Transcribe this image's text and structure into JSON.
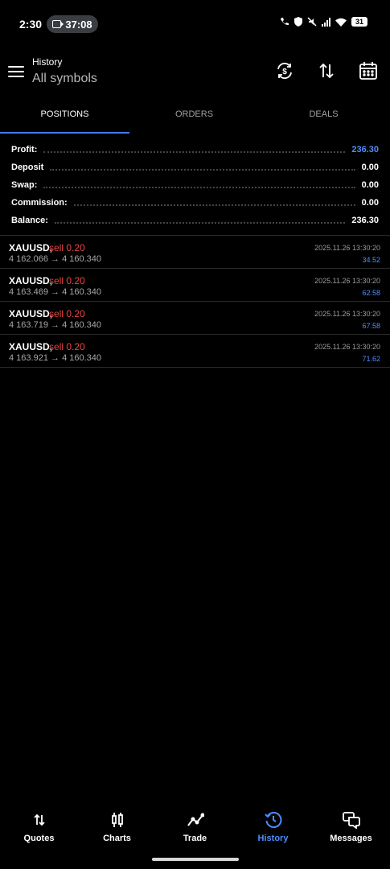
{
  "status_bar": {
    "time": "2:30",
    "call_timer": "37:08",
    "battery": "31"
  },
  "header": {
    "title": "History",
    "subtitle": "All symbols"
  },
  "tabs": [
    {
      "label": "POSITIONS",
      "active": true
    },
    {
      "label": "ORDERS",
      "active": false
    },
    {
      "label": "DEALS",
      "active": false
    }
  ],
  "summary": [
    {
      "label": "Profit:",
      "value": "236.30"
    },
    {
      "label": "Deposit",
      "value": "0.00"
    },
    {
      "label": "Swap:",
      "value": "0.00"
    },
    {
      "label": "Commission:",
      "value": "0.00"
    },
    {
      "label": "Balance:",
      "value": "236.30"
    }
  ],
  "positions": [
    {
      "symbol": "XAUUSD,",
      "side": "sell 0.20",
      "open": "4 162.066",
      "arrow": "→",
      "close": "4 160.340",
      "time": "2025.11.26 13:30:20",
      "profit": "34.52"
    },
    {
      "symbol": "XAUUSD,",
      "side": "sell 0.20",
      "open": "4 163.469",
      "arrow": "→",
      "close": "4 160.340",
      "time": "2025.11.26 13:30:20",
      "profit": "62.58"
    },
    {
      "symbol": "XAUUSD,",
      "side": "sell 0.20",
      "open": "4 163.719",
      "arrow": "→",
      "close": "4 160.340",
      "time": "2025.11.26 13:30:20",
      "profit": "67.58"
    },
    {
      "symbol": "XAUUSD,",
      "side": "sell 0.20",
      "open": "4 163.921",
      "arrow": "→",
      "close": "4 160.340",
      "time": "2025.11.26 13:30:20",
      "profit": "71.62"
    }
  ],
  "bottom_nav": [
    {
      "label": "Quotes",
      "icon": "quotes-icon",
      "active": false
    },
    {
      "label": "Charts",
      "icon": "charts-icon",
      "active": false
    },
    {
      "label": "Trade",
      "icon": "trade-icon",
      "active": false
    },
    {
      "label": "History",
      "icon": "history-icon",
      "active": true
    },
    {
      "label": "Messages",
      "icon": "messages-icon",
      "active": false
    }
  ],
  "colors": {
    "accent": "#4d8eff",
    "sell": "#e84545",
    "background": "#000000"
  }
}
